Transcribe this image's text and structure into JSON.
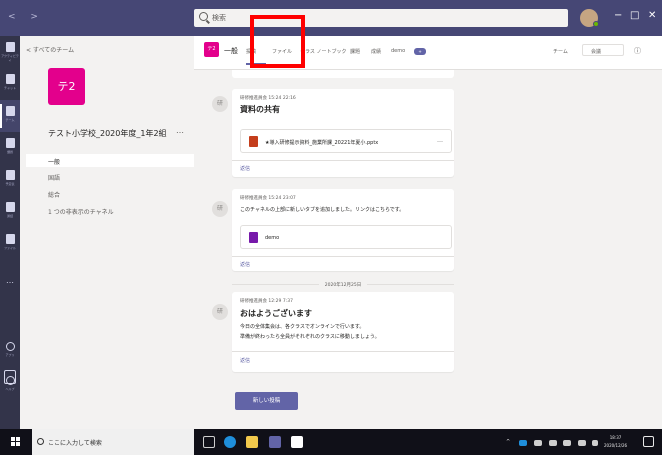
{
  "titlebar": {
    "nav": "< >",
    "search_placeholder": "検索",
    "window_controls": [
      "−",
      "□",
      "✕"
    ]
  },
  "rail": {
    "items": [
      {
        "label": "アクティビティ",
        "icon": "bell-icon"
      },
      {
        "label": "チャット",
        "icon": "chat-icon"
      },
      {
        "label": "チーム",
        "icon": "teams-icon",
        "active": true
      },
      {
        "label": "課題",
        "icon": "assignments-icon"
      },
      {
        "label": "予定表",
        "icon": "calendar-icon"
      },
      {
        "label": "通話",
        "icon": "phone-icon"
      },
      {
        "label": "ファイル",
        "icon": "files-icon"
      }
    ],
    "more": "…",
    "apps_label": "アプリ",
    "help_label": "ヘルプ"
  },
  "team": {
    "back_label": "< すべてのチーム",
    "avatar_text": "テ2",
    "name": "テスト小学校_2020年度_1年2組",
    "more": "…",
    "channels": [
      "一般",
      "国語",
      "総合",
      "1 つの非表示のチャネル"
    ]
  },
  "channel_header": {
    "avatar_text": "テ2",
    "title": "一般",
    "tabs": [
      "投稿",
      "ファイル",
      "クラス ノートブック",
      "課題",
      "成績",
      "demo"
    ],
    "tab_badge": "+",
    "team_button": "チーム",
    "meet_button": "会議",
    "info_icon": "ⓘ"
  },
  "posts": [
    {
      "avatar": "研",
      "meta": "研修推進員会  15:24 22:16",
      "title": "資料の共有",
      "attachment": {
        "name": "★導入研修提示資料_施業所課_20221年夏小.pptx",
        "type": "pptx",
        "more": "…"
      },
      "reply": "返信"
    },
    {
      "avatar": "研",
      "meta": "研修推進員会  15:24 23:07",
      "body": "このチャネルの上部に新しいタブを追加しました。リンクはこちらです。",
      "attachment": {
        "name": "demo",
        "type": "onenote"
      },
      "reply": "返信"
    },
    {
      "avatar": "研",
      "meta": "研修推進員会  12:29 7:37",
      "title": "おはようございます",
      "body_lines": [
        "今日の全体集会は、各クラスでオンラインで行います。",
        "準備が終わったら全員がそれぞれのクラスに移動しましょう。"
      ],
      "reply": "返信"
    }
  ],
  "date_divider": "2020年12月25日",
  "new_post_button": "新しい投稿",
  "taskbar": {
    "search_placeholder": "ここに入力して検索",
    "clock_time": "18:37",
    "clock_date": "2020/12/26"
  },
  "colors": {
    "titlebar": "#464775",
    "rail": "#33344a",
    "accent": "#6264a7",
    "team_tile": "#e3008c",
    "highlight_box": "#ff0000"
  }
}
